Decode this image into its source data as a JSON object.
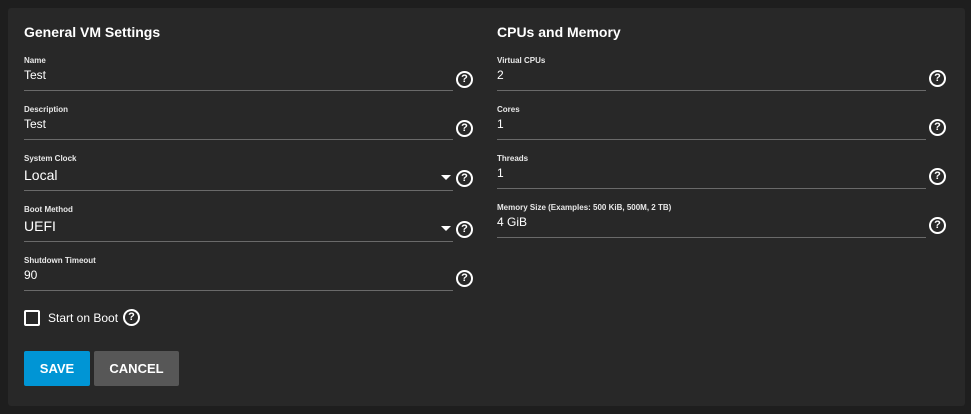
{
  "general": {
    "title": "General VM Settings",
    "name_label": "Name",
    "name_value": "Test",
    "description_label": "Description",
    "description_value": "Test",
    "clock_label": "System Clock",
    "clock_value": "Local",
    "boot_label": "Boot Method",
    "boot_value": "UEFI",
    "shutdown_label": "Shutdown Timeout",
    "shutdown_value": "90",
    "start_on_boot_label": "Start on Boot",
    "start_on_boot_checked": false
  },
  "cpu_memory": {
    "title": "CPUs and Memory",
    "vcpus_label": "Virtual CPUs",
    "vcpus_value": "2",
    "cores_label": "Cores",
    "cores_value": "1",
    "threads_label": "Threads",
    "threads_value": "1",
    "memory_label": "Memory Size (Examples: 500 KiB, 500M, 2 TB)",
    "memory_value": "4 GiB"
  },
  "help_glyph": "?",
  "actions": {
    "save_label": "SAVE",
    "cancel_label": "CANCEL"
  },
  "colors": {
    "background": "#1e1e1e",
    "card": "#282828",
    "save_button": "#0095d5",
    "cancel_button": "#575757"
  }
}
